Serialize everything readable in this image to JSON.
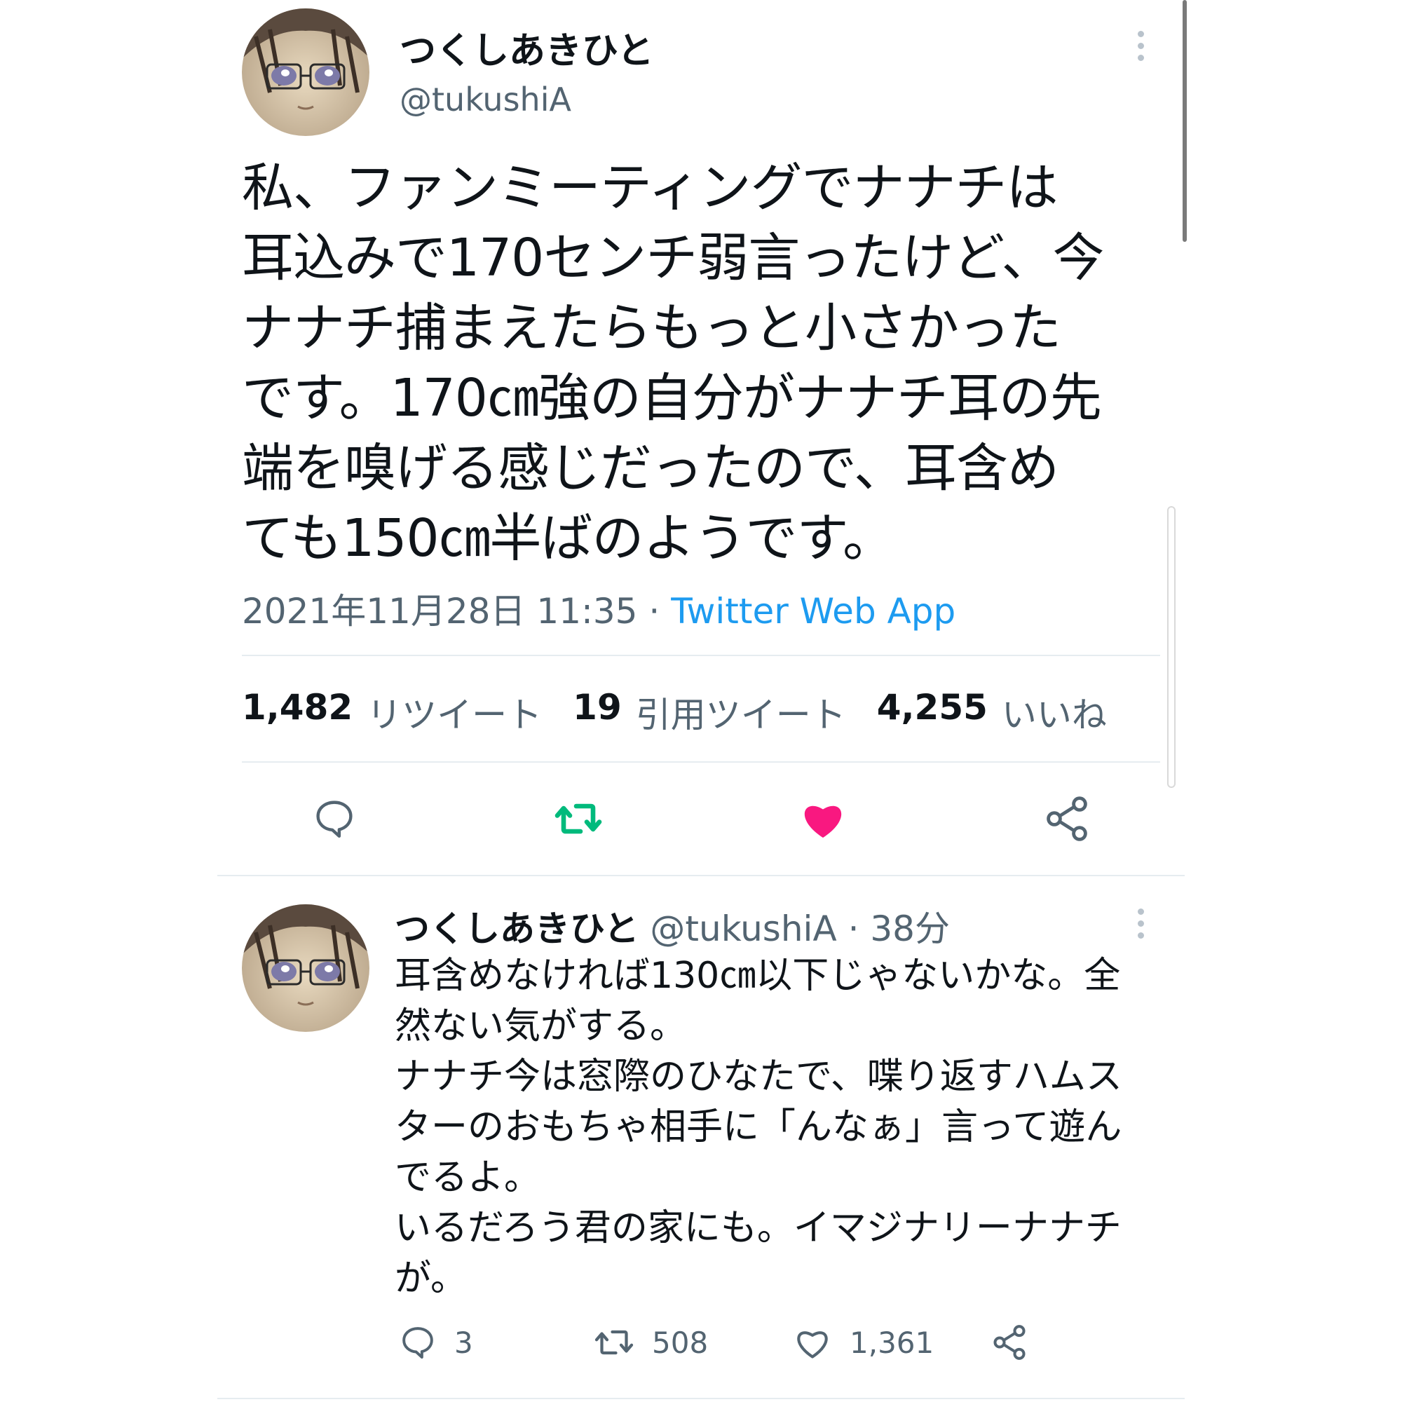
{
  "main_tweet": {
    "author_name": "つくしあきひと",
    "author_handle": "@tukushiA",
    "text": "私、ファンミーティングでナナチは\n耳込みで170センチ弱言ったけど、今\nナナチ捕まえたらもっと小さかった\nです。170㎝強の自分がナナチ耳の先\n端を嗅げる感じだったので、耳含め\nても150㎝半ばのようです。",
    "timestamp": "2021年11月28日 11:35",
    "separator": "·",
    "source_app": "Twitter Web App",
    "stats": {
      "retweets_count": "1,482",
      "retweets_label": "リツイート",
      "quotes_count": "19",
      "quotes_label": "引用ツイート",
      "likes_count": "4,255",
      "likes_label": "いいね"
    },
    "actions": {
      "reply_icon": "reply-icon",
      "retweet_icon": "retweet-icon",
      "like_icon": "heart-icon",
      "share_icon": "share-icon"
    }
  },
  "reply_tweet": {
    "author_name": "つくしあきひと",
    "author_handle": "@tukushiA",
    "separator": "·",
    "relative_time": "38分",
    "text": "耳含めなければ130㎝以下じゃないかな。全\n然ない気がする。\nナナチ今は窓際のひなたで、喋り返すハムス\nターのおもちゃ相手に「んなぁ」言って遊ん\nでるよ。\nいるだろう君の家にも。イマジナリーナナチ\nが。",
    "reply_count": "3",
    "retweet_count": "508",
    "like_count": "1,361"
  },
  "colors": {
    "text_primary": "#0f1419",
    "text_secondary": "#536471",
    "link": "#1d9bf0",
    "retweet_active": "#00ba7c",
    "like_active": "#f91880",
    "divider": "#e6ecf0"
  }
}
